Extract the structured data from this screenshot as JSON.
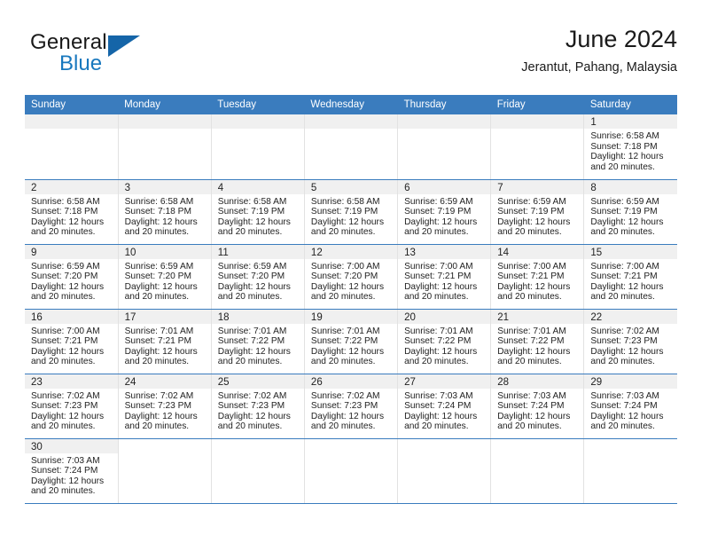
{
  "logo": {
    "word1": "General",
    "word2": "Blue",
    "triangle_color": "#1565a8",
    "blue_color": "#1878be"
  },
  "header": {
    "title": "June 2024",
    "subtitle": "Jerantut, Pahang, Malaysia"
  },
  "theme": {
    "header_bg": "#3a7cbe",
    "daynum_bg": "#f0f0f0",
    "row_divider": "#3a7cbe",
    "col_divider": "#e2e2e2"
  },
  "weekdays": [
    "Sunday",
    "Monday",
    "Tuesday",
    "Wednesday",
    "Thursday",
    "Friday",
    "Saturday"
  ],
  "labels": {
    "sunrise_prefix": "Sunrise:",
    "sunset_prefix": "Sunset:",
    "daylight_prefix": "Daylight:"
  },
  "weeks": [
    [
      {
        "day": "",
        "blank": true
      },
      {
        "day": "",
        "blank": true
      },
      {
        "day": "",
        "blank": true
      },
      {
        "day": "",
        "blank": true
      },
      {
        "day": "",
        "blank": true
      },
      {
        "day": "",
        "blank": true
      },
      {
        "day": "1",
        "sunrise": "Sunrise: 6:58 AM",
        "sunset": "Sunset: 7:18 PM",
        "daylight1": "Daylight: 12 hours",
        "daylight2": "and 20 minutes."
      }
    ],
    [
      {
        "day": "2",
        "sunrise": "Sunrise: 6:58 AM",
        "sunset": "Sunset: 7:18 PM",
        "daylight1": "Daylight: 12 hours",
        "daylight2": "and 20 minutes."
      },
      {
        "day": "3",
        "sunrise": "Sunrise: 6:58 AM",
        "sunset": "Sunset: 7:18 PM",
        "daylight1": "Daylight: 12 hours",
        "daylight2": "and 20 minutes."
      },
      {
        "day": "4",
        "sunrise": "Sunrise: 6:58 AM",
        "sunset": "Sunset: 7:19 PM",
        "daylight1": "Daylight: 12 hours",
        "daylight2": "and 20 minutes."
      },
      {
        "day": "5",
        "sunrise": "Sunrise: 6:58 AM",
        "sunset": "Sunset: 7:19 PM",
        "daylight1": "Daylight: 12 hours",
        "daylight2": "and 20 minutes."
      },
      {
        "day": "6",
        "sunrise": "Sunrise: 6:59 AM",
        "sunset": "Sunset: 7:19 PM",
        "daylight1": "Daylight: 12 hours",
        "daylight2": "and 20 minutes."
      },
      {
        "day": "7",
        "sunrise": "Sunrise: 6:59 AM",
        "sunset": "Sunset: 7:19 PM",
        "daylight1": "Daylight: 12 hours",
        "daylight2": "and 20 minutes."
      },
      {
        "day": "8",
        "sunrise": "Sunrise: 6:59 AM",
        "sunset": "Sunset: 7:19 PM",
        "daylight1": "Daylight: 12 hours",
        "daylight2": "and 20 minutes."
      }
    ],
    [
      {
        "day": "9",
        "sunrise": "Sunrise: 6:59 AM",
        "sunset": "Sunset: 7:20 PM",
        "daylight1": "Daylight: 12 hours",
        "daylight2": "and 20 minutes."
      },
      {
        "day": "10",
        "sunrise": "Sunrise: 6:59 AM",
        "sunset": "Sunset: 7:20 PM",
        "daylight1": "Daylight: 12 hours",
        "daylight2": "and 20 minutes."
      },
      {
        "day": "11",
        "sunrise": "Sunrise: 6:59 AM",
        "sunset": "Sunset: 7:20 PM",
        "daylight1": "Daylight: 12 hours",
        "daylight2": "and 20 minutes."
      },
      {
        "day": "12",
        "sunrise": "Sunrise: 7:00 AM",
        "sunset": "Sunset: 7:20 PM",
        "daylight1": "Daylight: 12 hours",
        "daylight2": "and 20 minutes."
      },
      {
        "day": "13",
        "sunrise": "Sunrise: 7:00 AM",
        "sunset": "Sunset: 7:21 PM",
        "daylight1": "Daylight: 12 hours",
        "daylight2": "and 20 minutes."
      },
      {
        "day": "14",
        "sunrise": "Sunrise: 7:00 AM",
        "sunset": "Sunset: 7:21 PM",
        "daylight1": "Daylight: 12 hours",
        "daylight2": "and 20 minutes."
      },
      {
        "day": "15",
        "sunrise": "Sunrise: 7:00 AM",
        "sunset": "Sunset: 7:21 PM",
        "daylight1": "Daylight: 12 hours",
        "daylight2": "and 20 minutes."
      }
    ],
    [
      {
        "day": "16",
        "sunrise": "Sunrise: 7:00 AM",
        "sunset": "Sunset: 7:21 PM",
        "daylight1": "Daylight: 12 hours",
        "daylight2": "and 20 minutes."
      },
      {
        "day": "17",
        "sunrise": "Sunrise: 7:01 AM",
        "sunset": "Sunset: 7:21 PM",
        "daylight1": "Daylight: 12 hours",
        "daylight2": "and 20 minutes."
      },
      {
        "day": "18",
        "sunrise": "Sunrise: 7:01 AM",
        "sunset": "Sunset: 7:22 PM",
        "daylight1": "Daylight: 12 hours",
        "daylight2": "and 20 minutes."
      },
      {
        "day": "19",
        "sunrise": "Sunrise: 7:01 AM",
        "sunset": "Sunset: 7:22 PM",
        "daylight1": "Daylight: 12 hours",
        "daylight2": "and 20 minutes."
      },
      {
        "day": "20",
        "sunrise": "Sunrise: 7:01 AM",
        "sunset": "Sunset: 7:22 PM",
        "daylight1": "Daylight: 12 hours",
        "daylight2": "and 20 minutes."
      },
      {
        "day": "21",
        "sunrise": "Sunrise: 7:01 AM",
        "sunset": "Sunset: 7:22 PM",
        "daylight1": "Daylight: 12 hours",
        "daylight2": "and 20 minutes."
      },
      {
        "day": "22",
        "sunrise": "Sunrise: 7:02 AM",
        "sunset": "Sunset: 7:23 PM",
        "daylight1": "Daylight: 12 hours",
        "daylight2": "and 20 minutes."
      }
    ],
    [
      {
        "day": "23",
        "sunrise": "Sunrise: 7:02 AM",
        "sunset": "Sunset: 7:23 PM",
        "daylight1": "Daylight: 12 hours",
        "daylight2": "and 20 minutes."
      },
      {
        "day": "24",
        "sunrise": "Sunrise: 7:02 AM",
        "sunset": "Sunset: 7:23 PM",
        "daylight1": "Daylight: 12 hours",
        "daylight2": "and 20 minutes."
      },
      {
        "day": "25",
        "sunrise": "Sunrise: 7:02 AM",
        "sunset": "Sunset: 7:23 PM",
        "daylight1": "Daylight: 12 hours",
        "daylight2": "and 20 minutes."
      },
      {
        "day": "26",
        "sunrise": "Sunrise: 7:02 AM",
        "sunset": "Sunset: 7:23 PM",
        "daylight1": "Daylight: 12 hours",
        "daylight2": "and 20 minutes."
      },
      {
        "day": "27",
        "sunrise": "Sunrise: 7:03 AM",
        "sunset": "Sunset: 7:24 PM",
        "daylight1": "Daylight: 12 hours",
        "daylight2": "and 20 minutes."
      },
      {
        "day": "28",
        "sunrise": "Sunrise: 7:03 AM",
        "sunset": "Sunset: 7:24 PM",
        "daylight1": "Daylight: 12 hours",
        "daylight2": "and 20 minutes."
      },
      {
        "day": "29",
        "sunrise": "Sunrise: 7:03 AM",
        "sunset": "Sunset: 7:24 PM",
        "daylight1": "Daylight: 12 hours",
        "daylight2": "and 20 minutes."
      }
    ],
    [
      {
        "day": "30",
        "sunrise": "Sunrise: 7:03 AM",
        "sunset": "Sunset: 7:24 PM",
        "daylight1": "Daylight: 12 hours",
        "daylight2": "and 20 minutes."
      },
      {
        "day": "",
        "void": true
      },
      {
        "day": "",
        "void": true
      },
      {
        "day": "",
        "void": true
      },
      {
        "day": "",
        "void": true
      },
      {
        "day": "",
        "void": true
      },
      {
        "day": "",
        "void": true
      }
    ]
  ]
}
